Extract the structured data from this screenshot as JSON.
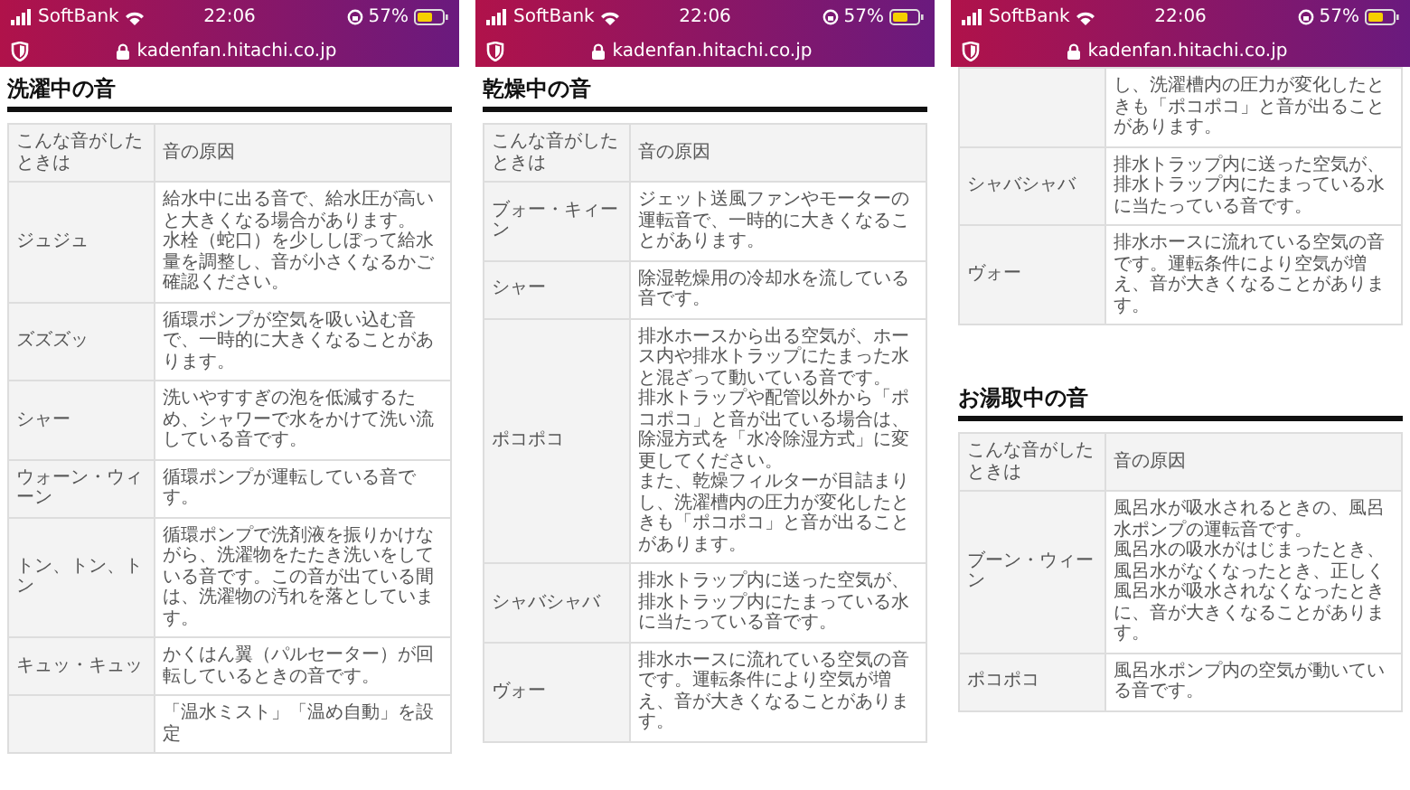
{
  "screens": [
    {
      "status_bar": {
        "carrier": "SoftBank",
        "time": "22:06",
        "battery": "57%"
      },
      "address_bar": {
        "url": "kadenfan.hitachi.co.jp"
      },
      "sections": [
        {
          "heading": "洗濯中の音",
          "table": {
            "columns": [
              "こんな音がしたときは",
              "音の原因"
            ],
            "rows": [
              {
                "sound": "ジュジュ",
                "cause": [
                  "給水中に出る音で、給水圧が高いと大きくなる場合があります。",
                  "水栓（蛇口）を少ししぼって給水量を調整し、音が小さくなるかご確認ください。"
                ]
              },
              {
                "sound": "ズズズッ",
                "cause": "循環ポンプが空気を吸い込む音で、一時的に大きくなることがあります。"
              },
              {
                "sound": "シャー",
                "cause": "洗いやすすぎの泡を低減するため、シャワーで水をかけて洗い流している音です。"
              },
              {
                "sound": "ウォーン・ウィーン",
                "cause": "循環ポンプが運転している音です。"
              },
              {
                "sound": "トン、トン、トン",
                "cause": "循環ポンプで洗剤液を振りかけながら、洗濯物をたたき洗いをしている音です。この音が出ている間は、洗濯物の汚れを落としています。"
              },
              {
                "sound": "キュッ・キュッ",
                "cause": "かくはん翼（パルセーター）が回転しているときの音です。"
              },
              {
                "cause": "「温水ミスト」「温め自動」を設定"
              }
            ]
          }
        }
      ]
    },
    {
      "status_bar": {
        "carrier": "SoftBank",
        "time": "22:06",
        "battery": "57%"
      },
      "address_bar": {
        "url": "kadenfan.hitachi.co.jp"
      },
      "sections": [
        {
          "heading": "乾燥中の音",
          "table": {
            "columns": [
              "こんな音がしたときは",
              "音の原因"
            ],
            "rows": [
              {
                "sound": "ブォー・キィーン",
                "cause": "ジェット送風ファンやモーターの運転音で、一時的に大きくなることがあります。"
              },
              {
                "sound": "シャー",
                "cause": "除湿乾燥用の冷却水を流している音です。"
              },
              {
                "sound": "ポコポコ",
                "cause": [
                  "排水ホースから出る空気が、ホース内や排水トラップにたまった水と混ざって動いている音です。",
                  "排水トラップや配管以外から「ポコポコ」と音が出ている場合は、除湿方式を「水冷除湿方式」に変更してください。",
                  "また、乾燥フィルターが目詰まりし、洗濯槽内の圧力が変化したときも「ポコポコ」と音が出ることがあります。"
                ]
              },
              {
                "sound": "シャバシャバ",
                "cause": "排水トラップ内に送った空気が、排水トラップ内にたまっている水に当たっている音です。"
              },
              {
                "sound": "ヴォー",
                "cause": "排水ホースに流れている空気の音です。運転条件により空気が増え、音が大きくなることがあります。"
              }
            ]
          }
        }
      ]
    },
    {
      "status_bar": {
        "carrier": "SoftBank",
        "time": "22:06",
        "battery": "57%"
      },
      "address_bar": {
        "url": "kadenfan.hitachi.co.jp"
      },
      "sections": [
        {
          "table": {
            "rows": [
              {
                "cause": "し、洗濯槽内の圧力が変化したときも「ポコポコ」と音が出ることがあります。"
              },
              {
                "sound": "シャバシャバ",
                "cause": "排水トラップ内に送った空気が、排水トラップ内にたまっている水に当たっている音です。"
              },
              {
                "sound": "ヴォー",
                "cause": "排水ホースに流れている空気の音です。運転条件により空気が増え、音が大きくなることがあります。"
              }
            ]
          }
        },
        {
          "heading": "お湯取中の音",
          "table": {
            "columns": [
              "こんな音がしたときは",
              "音の原因"
            ],
            "rows": [
              {
                "sound": "ブーン・ウィーン",
                "cause": [
                  "風呂水が吸水されるときの、風呂水ポンプの運転音です。",
                  "風呂水の吸水がはじまったとき、風呂水がなくなったとき、正しく風呂水が吸水されなくなったときに、音が大きくなることがあります。"
                ]
              },
              {
                "sound": "ポコポコ",
                "cause": "風呂水ポンプ内の空気が動いている音です。"
              }
            ]
          }
        }
      ]
    }
  ]
}
